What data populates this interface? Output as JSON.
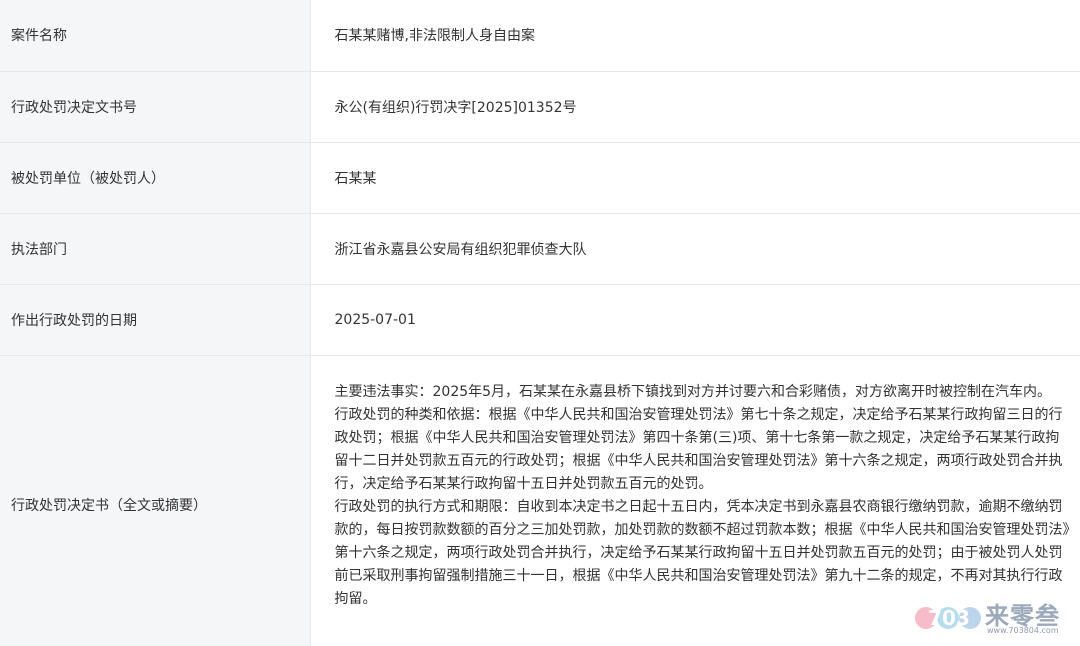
{
  "rows": [
    {
      "label": "案件名称",
      "value": "石某某赌博,非法限制人身自由案"
    },
    {
      "label": "行政处罚决定文书号",
      "value": "永公(有组织)行罚决字[2025]01352号"
    },
    {
      "label": "被处罚单位（被处罚人）",
      "value": "石某某"
    },
    {
      "label": "执法部门",
      "value": "浙江省永嘉县公安局有组织犯罪侦查大队"
    },
    {
      "label": "作出行政处罚的日期",
      "value": "2025-07-01"
    }
  ],
  "decision": {
    "label": "行政处罚决定书（全文或摘要）",
    "paragraphs": [
      "主要违法事实：2025年5月，石某某在永嘉县桥下镇找到对方并讨要六和合彩赌债，对方欲离开时被控制在汽车内。",
      "行政处罚的种类和依据：根据《中华人民共和国治安管理处罚法》第七十条之规定，决定给予石某某行政拘留三日的行政处罚；根据《中华人民共和国治安管理处罚法》第四十条第(三)项、第十七条第一款之规定，决定给予石某某行政拘留十二日并处罚款五百元的行政处罚；根据《中华人民共和国治安管理处罚法》第十六条之规定，两项行政处罚合并执行，决定给予石某某行政拘留十五日并处罚款五百元的处罚。",
      "行政处罚的执行方式和期限：自收到本决定书之日起十五日内，凭本决定书到永嘉县农商银行缴纳罚款，逾期不缴纳罚款的，每日按罚款数额的百分之三加处罚款，加处罚款的数额不超过罚款本数；根据《中华人民共和国治安管理处罚法》第十六条之规定，两项行政处罚合并执行，决定给予石某某行政拘留十五日并处罚款五百元的处罚；由于被处罚人处罚前已采取刑事拘留强制措施三十一日，根据《中华人民共和国治安管理处罚法》第九十二条的规定，不再对其执行行政拘留。"
    ]
  },
  "watermark": {
    "logo_text": "703",
    "brand": "来零叁",
    "url": "www.703804.com"
  }
}
